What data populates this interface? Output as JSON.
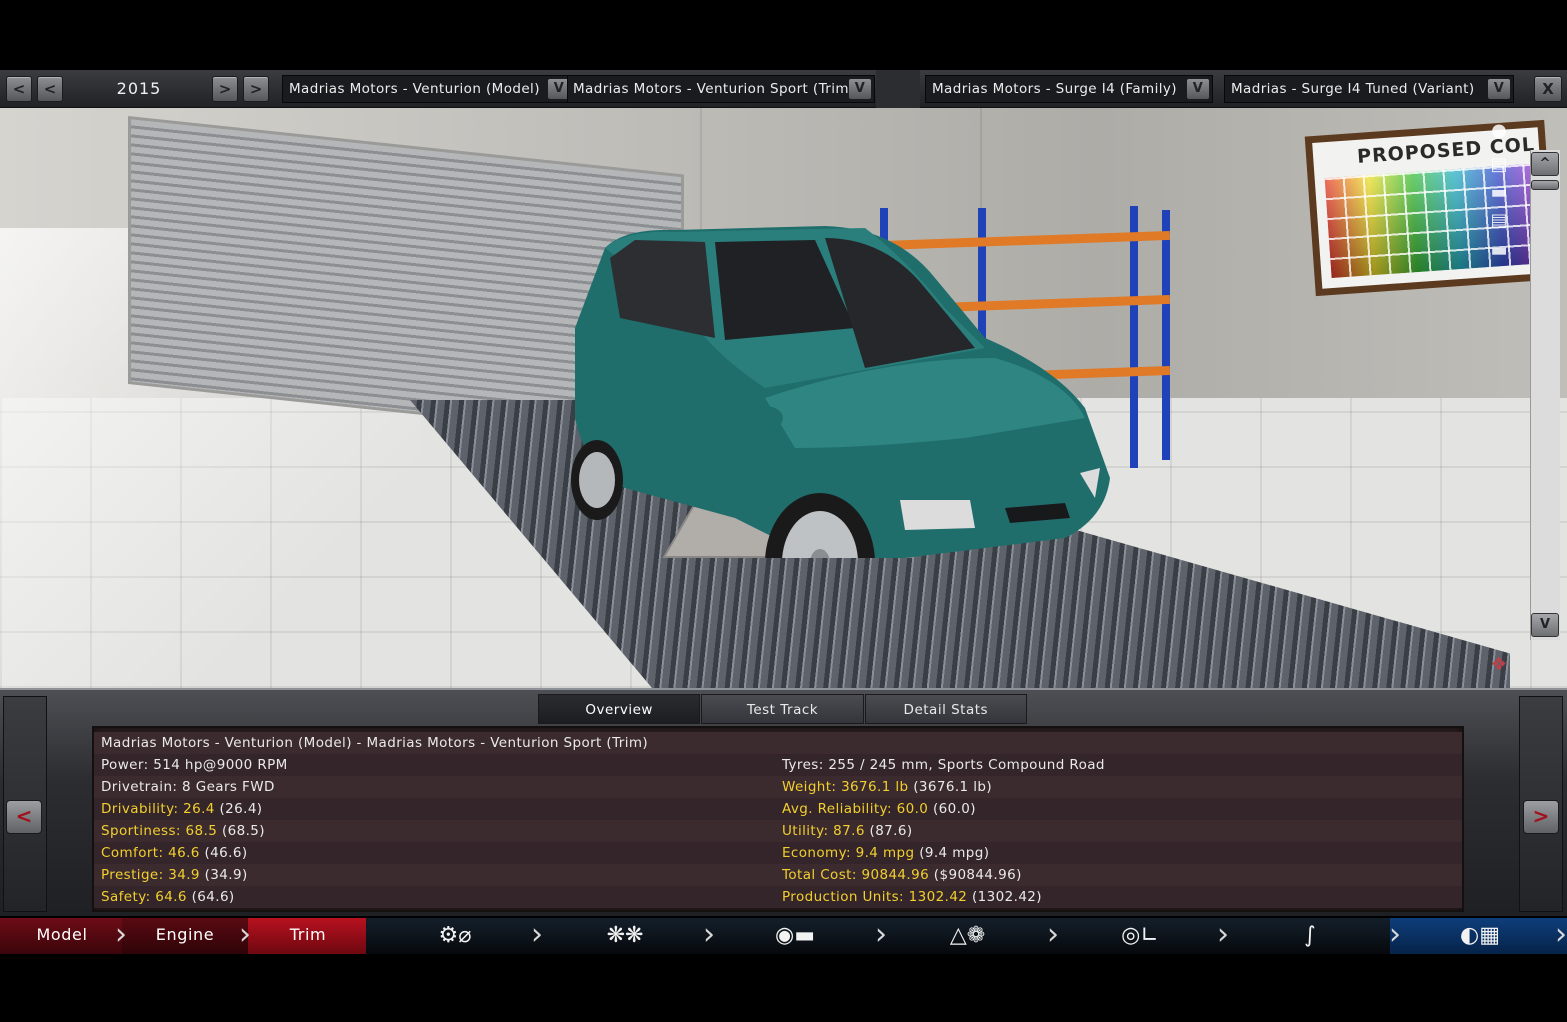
{
  "top_bar": {
    "prev_fast": "<",
    "prev": "<",
    "year": "2015",
    "next": ">",
    "next_fast": ">",
    "model_dropdown": "Madrias Motors - Venturion (Model)",
    "trim_dropdown": "Madrias Motors - Venturion Sport (Trim)",
    "family_dropdown": "Madrias Motors - Surge I4 (Family)",
    "variant_dropdown": "Madrias - Surge I4 Tuned (Variant)",
    "dropdown_arrow": "V",
    "close": "X"
  },
  "viewport": {
    "board_text": "PROPOSED COL",
    "scroll_up": "^",
    "scroll_down": "V"
  },
  "panel": {
    "tabs": [
      "Overview",
      "Test Track",
      "Detail Stats"
    ],
    "active_tab": "Overview",
    "prev_button": "<",
    "next_button": ">",
    "header": "Madrias Motors - Venturion (Model) - Madrias Motors - Venturion Sport (Trim)",
    "left_stats": [
      {
        "label": "Power: 514 hp@9000 RPM",
        "extra": "",
        "highlight": false
      },
      {
        "label": "Drivetrain: 8 Gears FWD",
        "extra": "",
        "highlight": false
      },
      {
        "label": "Drivability: 26.4",
        "extra": "(26.4)",
        "highlight": true
      },
      {
        "label": "Sportiness: 68.5",
        "extra": "(68.5)",
        "highlight": true
      },
      {
        "label": "Comfort: 46.6",
        "extra": "(46.6)",
        "highlight": true
      },
      {
        "label": "Prestige: 34.9",
        "extra": "(34.9)",
        "highlight": true
      },
      {
        "label": "Safety: 64.6",
        "extra": "(64.6)",
        "highlight": true
      }
    ],
    "right_stats": [
      {
        "label": "Tyres: 255 / 245 mm, Sports Compound Road",
        "extra": "",
        "highlight": false
      },
      {
        "label": "Weight: 3676.1 lb",
        "extra": "(3676.1 lb)",
        "highlight": true
      },
      {
        "label": "Avg. Reliability: 60.0",
        "extra": "(60.0)",
        "highlight": true
      },
      {
        "label": "Utility: 87.6",
        "extra": "(87.6)",
        "highlight": true
      },
      {
        "label": "Economy: 9.4 mpg",
        "extra": "(9.4 mpg)",
        "highlight": true
      },
      {
        "label": "Total Cost: 90844.96",
        "extra": "($90844.96)",
        "highlight": true
      },
      {
        "label": "Production Units: 1302.42",
        "extra": "(1302.42)",
        "highlight": true
      }
    ]
  },
  "nav": {
    "model": "Model",
    "engine": "Engine",
    "trim": "Trim",
    "icons": [
      "gearbox-icon",
      "wheels-icon",
      "brakes-body-icon",
      "aero-car-icon",
      "interior-icon",
      "suspension-icon",
      "test-drive-icon"
    ]
  },
  "colors": {
    "highlight_text": "#f2cf2e",
    "active_tab_red": "#a0121e",
    "car_teal": "#1f6e6c",
    "rack_blue": "#2042b8",
    "rack_orange": "#e07a26"
  }
}
